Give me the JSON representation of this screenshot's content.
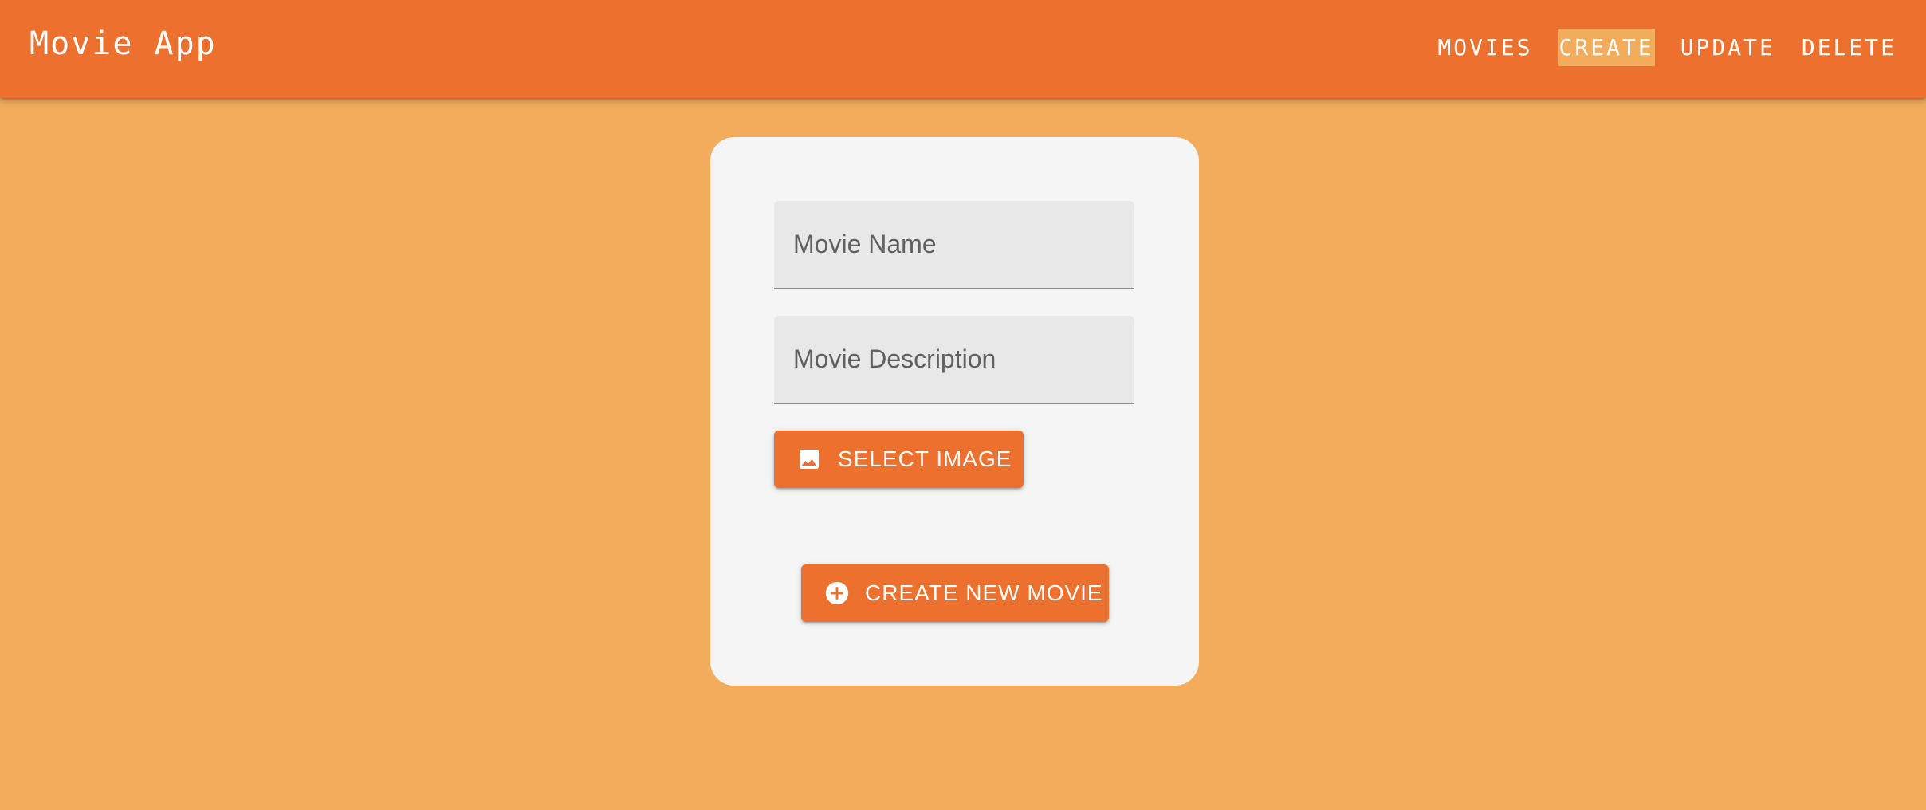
{
  "appbar": {
    "title": "Movie App",
    "nav": [
      {
        "label": "MOVIES",
        "active": false
      },
      {
        "label": "CREATE",
        "active": true
      },
      {
        "label": "UPDATE",
        "active": false
      },
      {
        "label": "DELETE",
        "active": false
      }
    ]
  },
  "form": {
    "movie_name": {
      "placeholder": "Movie Name",
      "value": ""
    },
    "movie_description": {
      "placeholder": "Movie Description",
      "value": ""
    },
    "select_image_label": "SELECT IMAGE",
    "select_image_icon": "image-icon",
    "create_label": "CREATE NEW MOVIE",
    "create_icon": "add-circle-icon"
  },
  "colors": {
    "appbar": "#EC702E",
    "background": "#F2AC5C",
    "card": "#F5F5F5",
    "field": "#E8E8E8",
    "button": "#EC702E",
    "active_nav": "#F2AC5C"
  }
}
